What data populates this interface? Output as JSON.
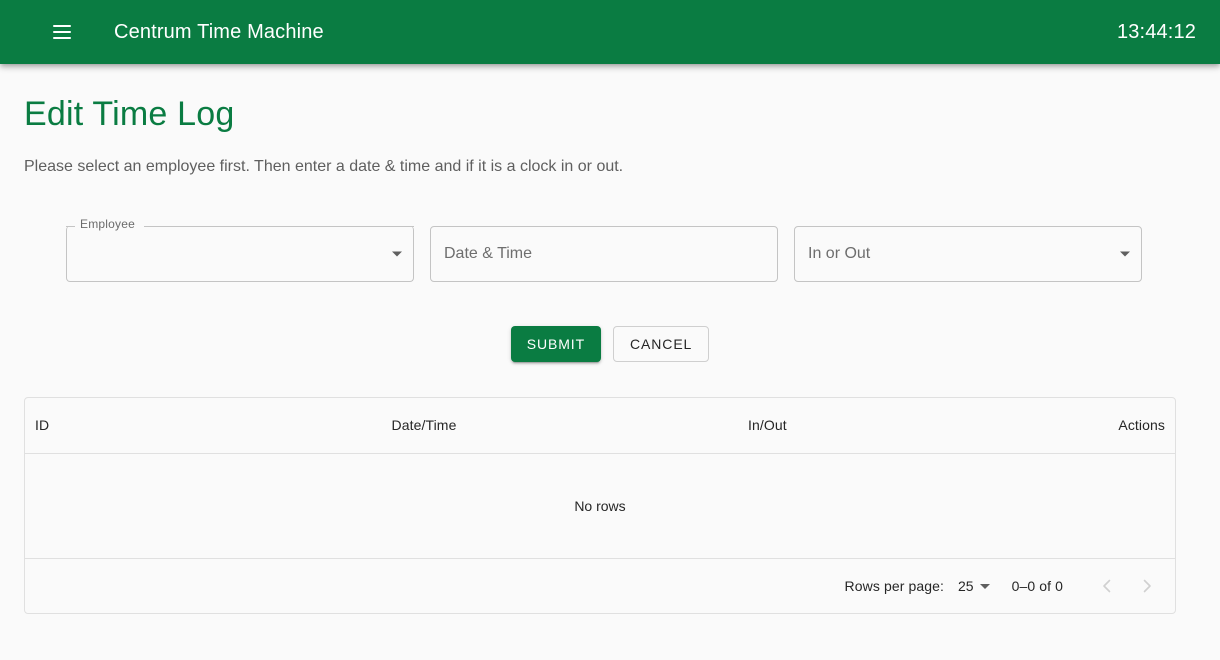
{
  "theme": {
    "primary": "#0a7c42",
    "background": "#fafafa",
    "border": "#e0e0e0",
    "text": "#262626",
    "muted": "#5f5f5f"
  },
  "appbar": {
    "menu_icon": "hamburger-menu-icon",
    "title": "Centrum Time Machine",
    "clock": "13:44:12"
  },
  "page": {
    "title": "Edit Time Log",
    "subtitle": "Please select an employee first. Then enter a date & time and if it is a clock in or out."
  },
  "form": {
    "employee": {
      "label": "Employee",
      "value": "",
      "caret_icon": "chevron-down-icon"
    },
    "datetime": {
      "placeholder": "Date & Time",
      "value": ""
    },
    "inout": {
      "placeholder": "In or Out",
      "value": "",
      "caret_icon": "chevron-down-icon"
    }
  },
  "actions": {
    "submit_label": "SUBMIT",
    "cancel_label": "CANCEL"
  },
  "table": {
    "columns": [
      "ID",
      "Date/Time",
      "In/Out",
      "Actions"
    ],
    "rows": [],
    "empty_message": "No rows"
  },
  "pagination": {
    "rows_per_page_label": "Rows per page:",
    "rows_per_page_value": "25",
    "displayed_rows": "0–0 of 0",
    "prev_icon": "chevron-left-icon",
    "next_icon": "chevron-right-icon"
  }
}
